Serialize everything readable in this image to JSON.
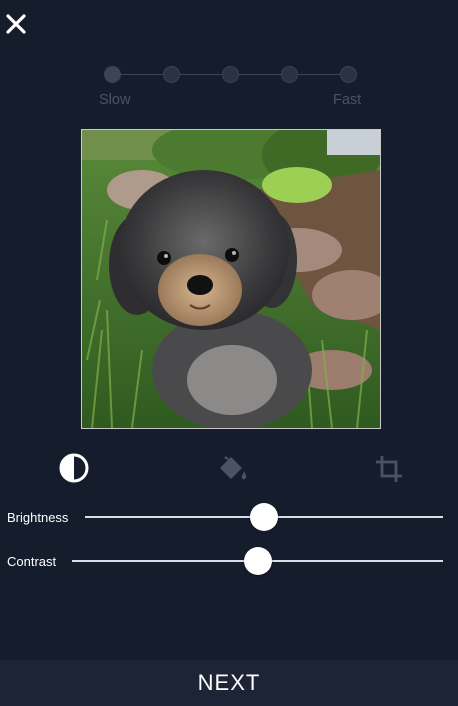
{
  "header": {
    "close_icon": "close-icon"
  },
  "speed": {
    "label_slow": "Slow",
    "label_fast": "Fast",
    "steps": 5,
    "selected_index": 0
  },
  "photo": {
    "alt": "Small gray and tan fluffy dog sitting in grass"
  },
  "tools": [
    {
      "name": "contrast-icon",
      "active": true
    },
    {
      "name": "paint-bucket-icon",
      "active": false
    },
    {
      "name": "crop-icon",
      "active": false
    }
  ],
  "adjustments": {
    "brightness_label": "Brightness",
    "brightness_value": 0.5,
    "contrast_label": "Contrast",
    "contrast_value": 0.5
  },
  "footer": {
    "next_label": "NEXT"
  },
  "colors": {
    "background": "#151c2c",
    "footer": "#1c2435",
    "inactive": "#4a5366"
  }
}
